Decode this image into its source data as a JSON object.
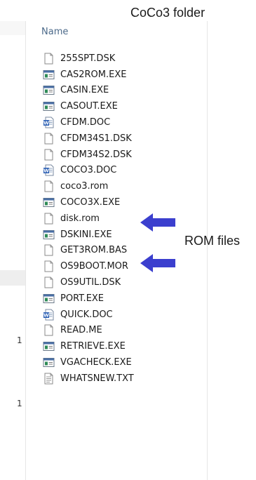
{
  "title": "CoCo3 folder",
  "column_header": "Name",
  "callout": "ROM files",
  "accent_color": "#3b3fce",
  "edge_marks": [
    "1",
    "1"
  ],
  "files": [
    {
      "name": "255SPT.DSK",
      "icon": "file-icon"
    },
    {
      "name": "CAS2ROM.EXE",
      "icon": "exe-icon"
    },
    {
      "name": "CASIN.EXE",
      "icon": "exe-icon"
    },
    {
      "name": "CASOUT.EXE",
      "icon": "exe-icon"
    },
    {
      "name": "CFDM.DOC",
      "icon": "word-doc-icon"
    },
    {
      "name": "CFDM34S1.DSK",
      "icon": "file-icon"
    },
    {
      "name": "CFDM34S2.DSK",
      "icon": "file-icon"
    },
    {
      "name": "COCO3.DOC",
      "icon": "word-doc-icon"
    },
    {
      "name": "coco3.rom",
      "icon": "file-icon"
    },
    {
      "name": "COCO3X.EXE",
      "icon": "exe-icon"
    },
    {
      "name": "disk.rom",
      "icon": "file-icon"
    },
    {
      "name": "DSKINI.EXE",
      "icon": "exe-icon"
    },
    {
      "name": "GET3ROM.BAS",
      "icon": "file-icon"
    },
    {
      "name": "OS9BOOT.MOR",
      "icon": "file-icon"
    },
    {
      "name": "OS9UTIL.DSK",
      "icon": "file-icon"
    },
    {
      "name": "PORT.EXE",
      "icon": "exe-icon"
    },
    {
      "name": "QUICK.DOC",
      "icon": "word-doc-icon"
    },
    {
      "name": "READ.ME",
      "icon": "file-icon"
    },
    {
      "name": "RETRIEVE.EXE",
      "icon": "exe-icon"
    },
    {
      "name": "VGACHECK.EXE",
      "icon": "exe-icon"
    },
    {
      "name": "WHATSNEW.TXT",
      "icon": "text-file-icon"
    }
  ]
}
